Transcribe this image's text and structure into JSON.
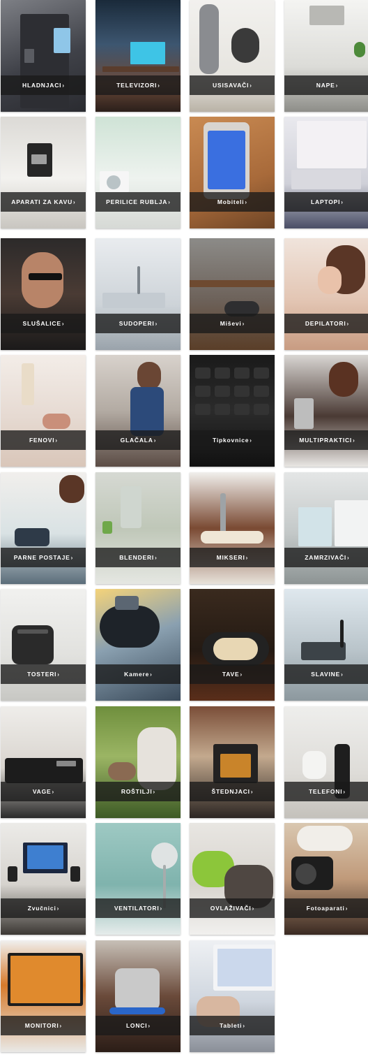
{
  "categories": [
    {
      "id": "hladnjaci",
      "label": "HLADNJACI",
      "bg": "linear-gradient(160deg,#7d7f85 0%,#3f4148 55%,#2a2b30 100%)"
    },
    {
      "id": "televizori",
      "label": "TELEVIZORI",
      "bg": "linear-gradient(180deg,#1a2a3a 0%,#3d5670 40%,#6b4a3a 75%,#2b1f1a 100%)"
    },
    {
      "id": "usisavaci",
      "label": "USISAVAČI",
      "bg": "linear-gradient(180deg,#f2f1ee 0%,#e6e4df 70%,#b9b2a6 100%)"
    },
    {
      "id": "nape",
      "label": "NAPE",
      "bg": "linear-gradient(180deg,#f4f4f2 0%,#dcdcd8 60%,#8d8d88 100%)"
    },
    {
      "id": "aparati-za-kavu",
      "label": "APARATI ZA KAVU",
      "bg": "linear-gradient(180deg,#dcdad6 0%,#f3f2ef 55%,#c9c6c0 100%)"
    },
    {
      "id": "perilice-rublja",
      "label": "PERILICE RUBLJA",
      "bg": "linear-gradient(180deg,#cfe3d6 0%,#eef3ef 55%,#d6d9d5 100%)"
    },
    {
      "id": "mobiteli",
      "label": "Mobiteli",
      "bg": "linear-gradient(160deg,#c98a52 0%,#a86a3a 60%,#6e4526 100%)"
    },
    {
      "id": "laptopi",
      "label": "LAPTOPI",
      "bg": "linear-gradient(180deg,#e9e9ee 0%,#cfd0d8 60%,#4a4e66 100%)"
    },
    {
      "id": "slusalice",
      "label": "SLUŠALICE",
      "bg": "linear-gradient(180deg,#2c2a2a 0%,#4a3b34 50%,#1b1a1a 100%)"
    },
    {
      "id": "sudoperi",
      "label": "SUDOPERI",
      "bg": "linear-gradient(180deg,#e9ecef 0%,#cdd3d8 60%,#9aa3ab 100%)"
    },
    {
      "id": "misevi",
      "label": "Miševi",
      "bg": "linear-gradient(180deg,#8c8b88 0%,#6d625a 55%,#5a3e28 100%)"
    },
    {
      "id": "depilatori",
      "label": "DEPILATORI",
      "bg": "linear-gradient(180deg,#f0e4dc 0%,#e3c6b4 55%,#c89c82 100%)"
    },
    {
      "id": "fenovi",
      "label": "FENOVI",
      "bg": "linear-gradient(180deg,#f3ede8 0%,#e6dad2 55%,#d9c6b9 100%)"
    },
    {
      "id": "glacala",
      "label": "GLAČALA",
      "bg": "linear-gradient(180deg,#d8d2cc 0%,#b3aba3 50%,#5b4c45 100%)"
    },
    {
      "id": "tipkovnice",
      "label": "Tipkovnice",
      "bg": "linear-gradient(180deg,#1a1a1a 0%,#2b2b2b 50%,#111111 100%)"
    },
    {
      "id": "multipraktici",
      "label": "MULTIPRAKTICI",
      "bg": "linear-gradient(180deg,#d9d6d3 0%,#4a3a34 55%,#e9e7e4 100%)"
    },
    {
      "id": "parne-postaje",
      "label": "PARNE POSTAJE",
      "bg": "linear-gradient(180deg,#f1efec 0%,#d9e2e4 55%,#5b6d7a 100%)"
    },
    {
      "id": "blenderi",
      "label": "BLENDERI",
      "bg": "linear-gradient(180deg,#d6d9d3 0%,#bfc7b8 50%,#e5e7e2 100%)"
    },
    {
      "id": "mikseri",
      "label": "MIKSERI",
      "bg": "linear-gradient(180deg,#f1efec 0%,#7a4a33 50%,#e8e2da 100%)"
    },
    {
      "id": "zamrzivaci",
      "label": "ZAMRZIVAČI",
      "bg": "linear-gradient(180deg,#e4e6e6 0%,#c3c8c8 55%,#8d9494 100%)"
    },
    {
      "id": "tosteri",
      "label": "TOSTERI",
      "bg": "linear-gradient(180deg,#f1f1ef 0%,#e1e1de 60%,#c7c7c3 100%)"
    },
    {
      "id": "kamere",
      "label": "Kamere",
      "bg": "linear-gradient(160deg,#f4d37a 0%,#8aa0b0 45%,#3a4a5a 100%)"
    },
    {
      "id": "tave",
      "label": "TAVE",
      "bg": "linear-gradient(180deg,#3a2a1e 0%,#241a13 55%,#5a2e1a 100%)"
    },
    {
      "id": "slavine",
      "label": "SLAVINE",
      "bg": "linear-gradient(180deg,#dfe8ee 0%,#b9c4ca 55%,#8c989e 100%)"
    },
    {
      "id": "vage",
      "label": "VAGE",
      "bg": "linear-gradient(180deg,#efedea 0%,#d9d5cf 55%,#2a2a2a 100%)"
    },
    {
      "id": "rostilji",
      "label": "ROŠTILJI",
      "bg": "linear-gradient(180deg,#6f8f3d 0%,#9bb564 45%,#3d5a25 100%)"
    },
    {
      "id": "stednjaci",
      "label": "ŠTEDNJACI",
      "bg": "linear-gradient(180deg,#7a4e38 0%,#c3a98e 45%,#2c2623 100%)"
    },
    {
      "id": "telefoni",
      "label": "TELEFONI",
      "bg": "linear-gradient(180deg,#eeeeec 0%,#dedcd8 60%,#c4c1bb 100%)"
    },
    {
      "id": "zvucnici",
      "label": "Zvučnici",
      "bg": "linear-gradient(180deg,#ecebe8 0%,#d6d3ce 55%,#3c3834 100%)"
    },
    {
      "id": "ventilatori",
      "label": "VENTILATORI",
      "bg": "linear-gradient(180deg,#9ec9c3 0%,#7fb3ad 55%,#e6eceb 100%)"
    },
    {
      "id": "ovlazivaci",
      "label": "OVLAŽIVAČI",
      "bg": "linear-gradient(180deg,#e8e6e2 0%,#d8d4ce 55%,#f1f0ee 100%)"
    },
    {
      "id": "fotoaparati",
      "label": "Fotoaparati",
      "bg": "linear-gradient(180deg,#d9c7b0 0%,#c09a7a 50%,#3a2a22 100%)"
    },
    {
      "id": "monitori",
      "label": "MONITORI",
      "bg": "linear-gradient(180deg,#f0f0ef 0%,#d67a2b 40%,#e9e9e7 100%)"
    },
    {
      "id": "lonci",
      "label": "LONCI",
      "bg": "linear-gradient(180deg,#c7c0b7 0%,#6a4a3a 50%,#2b1d17 100%)"
    },
    {
      "id": "tableti",
      "label": "Tableti",
      "bg": "linear-gradient(180deg,#eef0f3 0%,#cfd6df 55%,#8a8f98 100%)"
    }
  ],
  "chevron": "›"
}
